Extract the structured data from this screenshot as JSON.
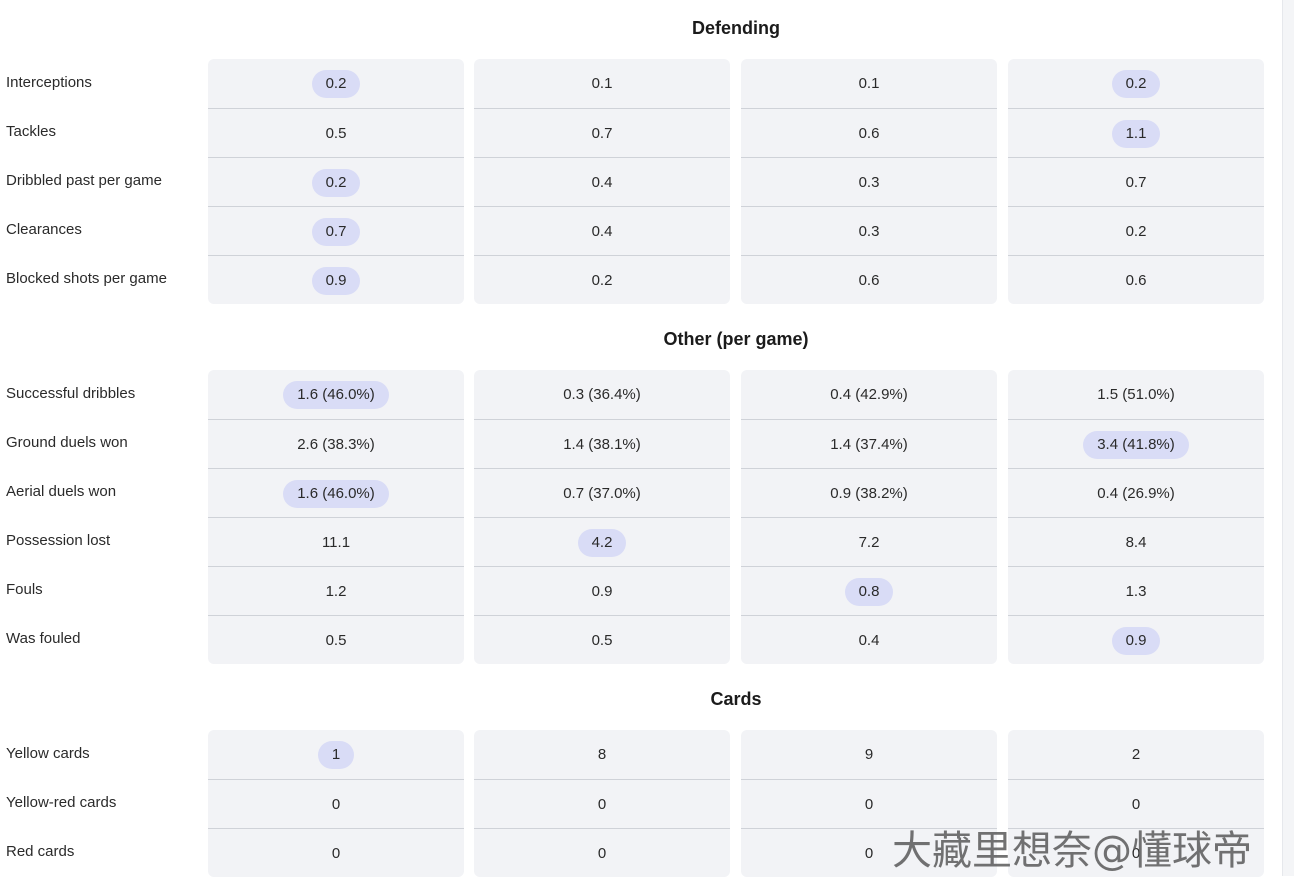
{
  "sections": [
    {
      "title": "Defending",
      "rows": [
        {
          "label": "Interceptions",
          "values": [
            "0.2",
            "0.1",
            "0.1",
            "0.2"
          ],
          "highlight": [
            true,
            false,
            false,
            true
          ]
        },
        {
          "label": "Tackles",
          "values": [
            "0.5",
            "0.7",
            "0.6",
            "1.1"
          ],
          "highlight": [
            false,
            false,
            false,
            true
          ]
        },
        {
          "label": "Dribbled past per game",
          "values": [
            "0.2",
            "0.4",
            "0.3",
            "0.7"
          ],
          "highlight": [
            true,
            false,
            false,
            false
          ]
        },
        {
          "label": "Clearances",
          "values": [
            "0.7",
            "0.4",
            "0.3",
            "0.2"
          ],
          "highlight": [
            true,
            false,
            false,
            false
          ]
        },
        {
          "label": "Blocked shots per game",
          "values": [
            "0.9",
            "0.2",
            "0.6",
            "0.6"
          ],
          "highlight": [
            true,
            false,
            false,
            false
          ]
        }
      ]
    },
    {
      "title": "Other (per game)",
      "rows": [
        {
          "label": "Successful dribbles",
          "values": [
            "1.6 (46.0%)",
            "0.3 (36.4%)",
            "0.4 (42.9%)",
            "1.5 (51.0%)"
          ],
          "highlight": [
            true,
            false,
            false,
            false
          ]
        },
        {
          "label": "Ground duels won",
          "values": [
            "2.6 (38.3%)",
            "1.4 (38.1%)",
            "1.4 (37.4%)",
            "3.4 (41.8%)"
          ],
          "highlight": [
            false,
            false,
            false,
            true
          ]
        },
        {
          "label": "Aerial duels won",
          "values": [
            "1.6 (46.0%)",
            "0.7 (37.0%)",
            "0.9 (38.2%)",
            "0.4 (26.9%)"
          ],
          "highlight": [
            true,
            false,
            false,
            false
          ]
        },
        {
          "label": "Possession lost",
          "values": [
            "11.1",
            "4.2",
            "7.2",
            "8.4"
          ],
          "highlight": [
            false,
            true,
            false,
            false
          ]
        },
        {
          "label": "Fouls",
          "values": [
            "1.2",
            "0.9",
            "0.8",
            "1.3"
          ],
          "highlight": [
            false,
            false,
            true,
            false
          ]
        },
        {
          "label": "Was fouled",
          "values": [
            "0.5",
            "0.5",
            "0.4",
            "0.9"
          ],
          "highlight": [
            false,
            false,
            false,
            true
          ]
        }
      ]
    },
    {
      "title": "Cards",
      "rows": [
        {
          "label": "Yellow cards",
          "values": [
            "1",
            "8",
            "9",
            "2"
          ],
          "highlight": [
            true,
            false,
            false,
            false
          ]
        },
        {
          "label": "Yellow-red cards",
          "values": [
            "0",
            "0",
            "0",
            "0"
          ],
          "highlight": [
            false,
            false,
            false,
            false
          ]
        },
        {
          "label": "Red cards",
          "values": [
            "0",
            "0",
            "0",
            "0"
          ],
          "highlight": [
            false,
            false,
            false,
            false
          ]
        }
      ]
    }
  ],
  "watermark": "大藏里想奈@懂球帝",
  "colors": {
    "highlight": "#d9dcf6",
    "cell_bg": "#f2f3f6",
    "separator": "#cfd2d8"
  }
}
